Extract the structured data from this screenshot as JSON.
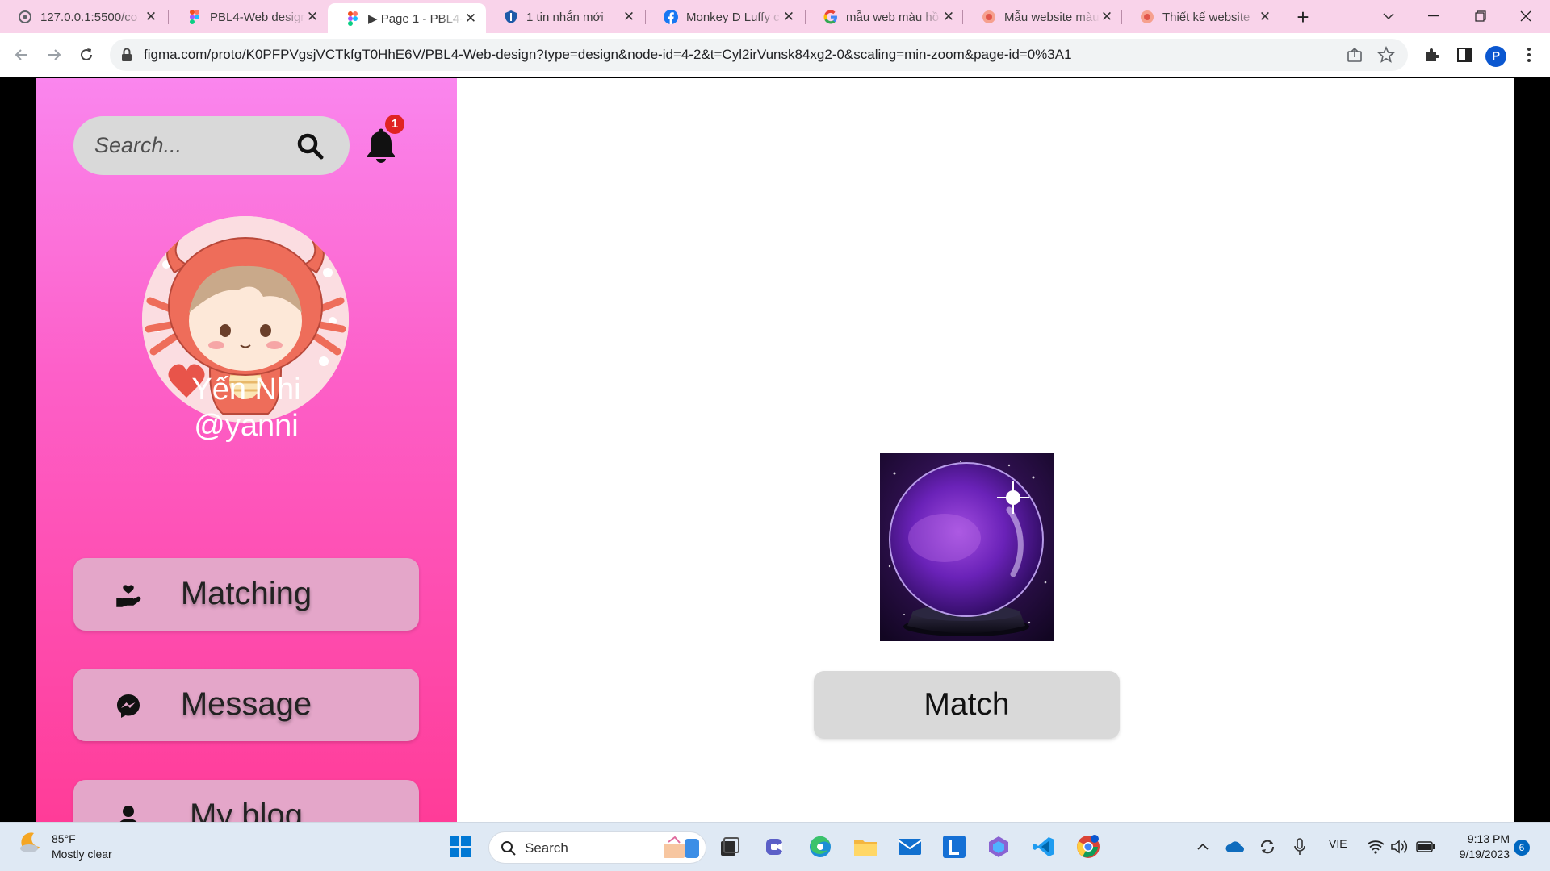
{
  "browser": {
    "tabs": [
      {
        "title": "127.0.0.1:5500/co",
        "favicon": "globe-icon"
      },
      {
        "title": "PBL4-Web design",
        "favicon": "figma-icon"
      },
      {
        "title": "▶ Page 1 - PBL4-",
        "favicon": "figma-icon",
        "active": true
      },
      {
        "title": "1 tin nhắn mới",
        "favicon": "shield-icon"
      },
      {
        "title": "Monkey D Luffy c",
        "favicon": "facebook-icon"
      },
      {
        "title": "mẫu web màu hồ",
        "favicon": "google-icon"
      },
      {
        "title": "Mẫu website màu",
        "favicon": "site-icon"
      },
      {
        "title": "Thiết kế website",
        "favicon": "site-icon"
      }
    ],
    "url": "figma.com/proto/K0PFPVgsjVCTkfgT0HhE6V/PBL4-Web-design?type=design&node-id=4-2&t=Cyl2irVunsk84xg2-0&scaling=min-zoom&page-id=0%3A1",
    "profile_initial": "P"
  },
  "sidebar": {
    "search_placeholder": "Search...",
    "notification_count": "1",
    "user_name": "Yến Nhi",
    "user_handle": "@yanni",
    "nav": [
      {
        "label": "Matching",
        "icon": "hand-heart-icon"
      },
      {
        "label": "Message",
        "icon": "messenger-icon"
      },
      {
        "label": "My blog",
        "icon": "person-icon"
      }
    ]
  },
  "main": {
    "match_button": "Match",
    "image_icon": "crystal-ball-icon"
  },
  "taskbar": {
    "weather_temp": "85°F",
    "weather_cond": "Mostly clear",
    "search_label": "Search",
    "language": "VIE",
    "time": "9:13 PM",
    "date": "9/19/2023",
    "notif_count": "6"
  },
  "colors": {
    "sidebar_top": "#fa86ee",
    "sidebar_bottom": "#ff3c98",
    "nav_card": "#e4a6c9",
    "button_gray": "#d9d9d9"
  }
}
